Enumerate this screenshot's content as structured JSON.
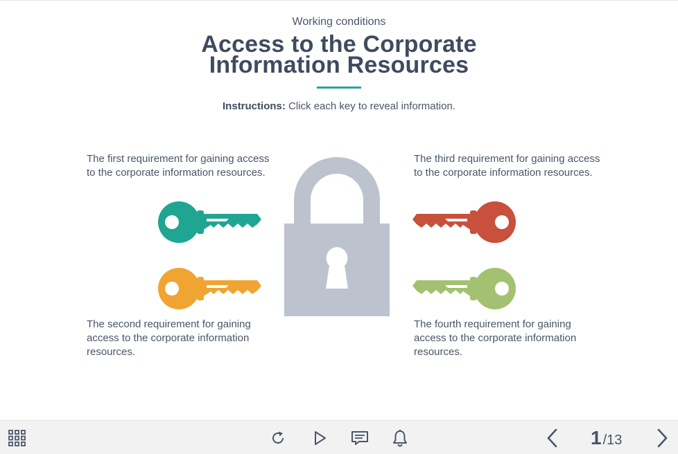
{
  "header": {
    "subtitle": "Working conditions",
    "title_line1": "Access to the Corporate",
    "title_line2": "Information Resources",
    "instructions_label": "Instructions:",
    "instructions_text": " Click each key to reveal information."
  },
  "requirements": [
    {
      "text": "The first requirement for gaining access to the corporate information resources.",
      "key_color": "#1fa592"
    },
    {
      "text": "The second requirement for gaining access to the corporate information resources.",
      "key_color": "#f0a432"
    },
    {
      "text": "The third requirement for gaining access to the corporate information resources.",
      "key_color": "#c8503c"
    },
    {
      "text": "The fourth requirement for gaining access to the corporate information resources.",
      "key_color": "#a3c170"
    }
  ],
  "padlock": {
    "color": "#bcc3ce"
  },
  "accent_color": "#26a595",
  "toolbar": {
    "menu_icon": "grid-menu-icon",
    "replay_icon": "replay-icon",
    "play_icon": "play-icon",
    "captions_icon": "captions-icon",
    "notify_icon": "bell-icon",
    "prev_icon": "chevron-left-icon",
    "next_icon": "chevron-right-icon",
    "current_page": "1",
    "separator": "/",
    "total_pages": "13"
  }
}
